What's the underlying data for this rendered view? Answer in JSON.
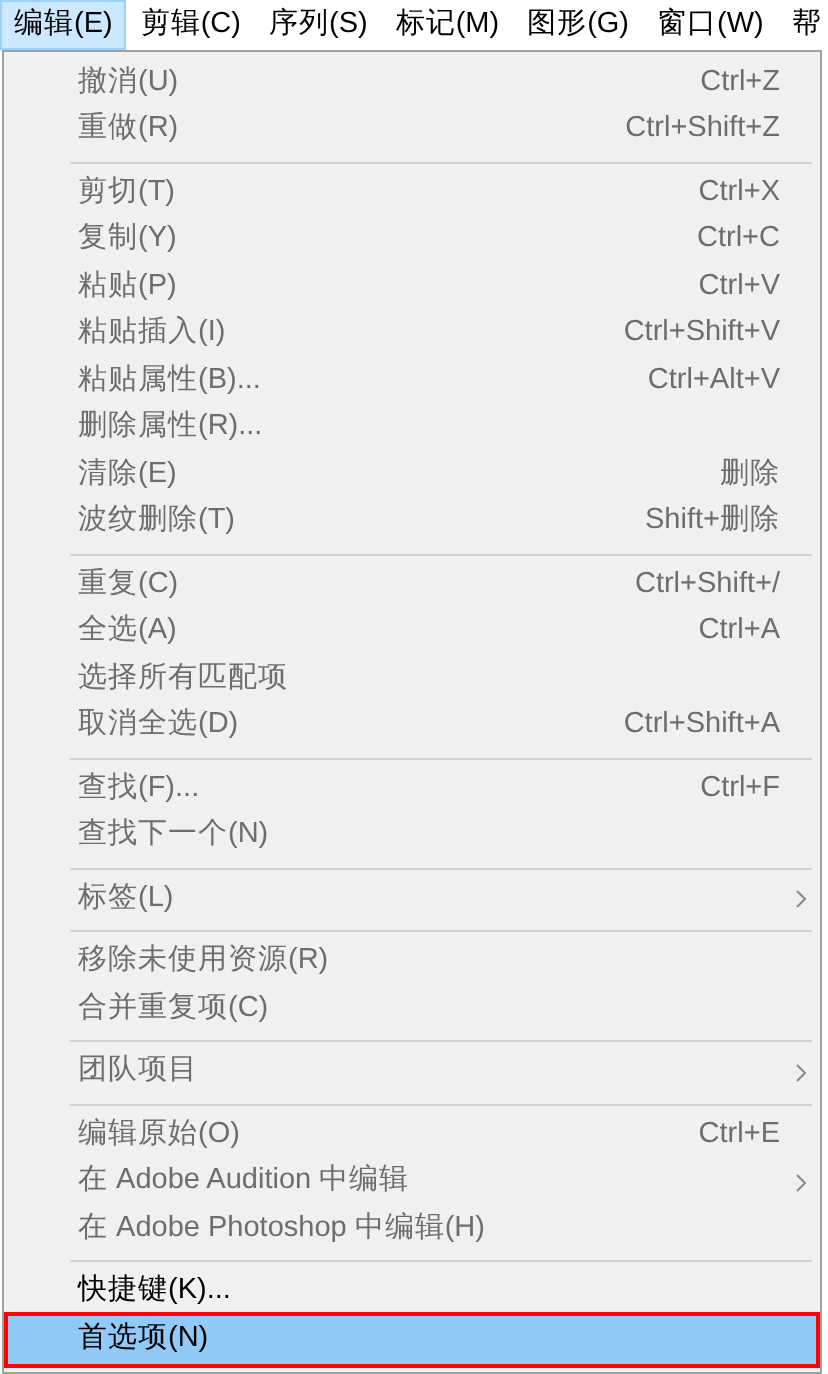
{
  "menu_bar": [
    {
      "label": "编辑(E)",
      "selected": true
    },
    {
      "label": "剪辑(C)",
      "selected": false
    },
    {
      "label": "序列(S)",
      "selected": false
    },
    {
      "label": "标记(M)",
      "selected": false
    },
    {
      "label": "图形(G)",
      "selected": false
    },
    {
      "label": "窗口(W)",
      "selected": false
    },
    {
      "label": "帮",
      "selected": false
    }
  ],
  "menu_sections": [
    [
      {
        "label": "撤消(U)",
        "shortcut": "Ctrl+Z",
        "disabled": true,
        "selected": false
      },
      {
        "label": "重做(R)",
        "shortcut": "Ctrl+Shift+Z",
        "disabled": true,
        "selected": false
      }
    ],
    [
      {
        "label": "剪切(T)",
        "shortcut": "Ctrl+X",
        "disabled": true,
        "selected": false
      },
      {
        "label": "复制(Y)",
        "shortcut": "Ctrl+C",
        "disabled": true,
        "selected": false
      },
      {
        "label": "粘贴(P)",
        "shortcut": "Ctrl+V",
        "disabled": true,
        "selected": false
      },
      {
        "label": "粘贴插入(I)",
        "shortcut": "Ctrl+Shift+V",
        "disabled": true,
        "selected": false
      },
      {
        "label": "粘贴属性(B)...",
        "shortcut": "Ctrl+Alt+V",
        "disabled": true,
        "selected": false
      },
      {
        "label": "删除属性(R)...",
        "disabled": true,
        "selected": false
      },
      {
        "label": "清除(E)",
        "shortcut": "删除",
        "disabled": true,
        "selected": false
      },
      {
        "label": "波纹删除(T)",
        "shortcut": "Shift+删除",
        "disabled": true,
        "selected": false
      }
    ],
    [
      {
        "label": "重复(C)",
        "shortcut": "Ctrl+Shift+/",
        "disabled": true,
        "selected": false
      },
      {
        "label": "全选(A)",
        "shortcut": "Ctrl+A",
        "disabled": true,
        "selected": false
      },
      {
        "label": "选择所有匹配项",
        "disabled": true,
        "selected": false
      },
      {
        "label": "取消全选(D)",
        "shortcut": "Ctrl+Shift+A",
        "disabled": true,
        "selected": false
      }
    ],
    [
      {
        "label": "查找(F)...",
        "shortcut": "Ctrl+F",
        "disabled": true,
        "selected": false
      },
      {
        "label": "查找下一个(N)",
        "disabled": true,
        "selected": false
      }
    ],
    [
      {
        "label": "标签(L)",
        "submenu": true,
        "disabled": true,
        "selected": false
      }
    ],
    [
      {
        "label": "移除未使用资源(R)",
        "disabled": true,
        "selected": false
      },
      {
        "label": "合并重复项(C)",
        "disabled": true,
        "selected": false
      }
    ],
    [
      {
        "label": "团队项目",
        "submenu": true,
        "disabled": true,
        "selected": false
      }
    ],
    [
      {
        "label": "编辑原始(O)",
        "shortcut": "Ctrl+E",
        "disabled": true,
        "selected": false
      },
      {
        "label": "在 Adobe Audition 中编辑",
        "submenu": true,
        "disabled": true,
        "selected": false
      },
      {
        "label": "在 Adobe Photoshop 中编辑(H)",
        "disabled": true,
        "selected": false
      }
    ],
    [
      {
        "label": "快捷键(K)...",
        "disabled": false,
        "selected": false
      },
      {
        "label": "首选项(N)",
        "disabled": false,
        "selected": true,
        "outlined": true
      }
    ]
  ]
}
